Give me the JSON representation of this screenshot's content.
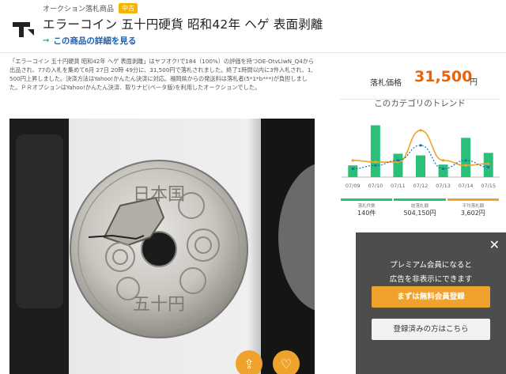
{
  "header": {
    "breadcrumb": "オークション落札商品",
    "badge": "中古",
    "title": "エラーコイン 五十円硬貨 昭和42年 ヘゲ 表面剥離",
    "detail_link": "この商品の詳細を見る"
  },
  "description": "「エラーコイン 五十円硬貨 昭和42年 ヘゲ 表面剥離」はヤフオク!で184（100%）の評価を持つOE-OtvLlwN_Q4から出品され、77の入札を集めて6月 27日 20時 49分に、31,500円で落札されました。終了1時間以内に3件入札され、1,500円上昇しました。決済方法はYahoo!かんたん決済に対応。福岡県からの発送料は落札者(5*1*b***)が負担しました。ＰＲオプションはYahoo!かんたん決済、取りナビ(ベータ版)を利用したオークションでした。",
  "photo": {
    "coin_text_top": "日本国",
    "coin_text_bottom": "五十円"
  },
  "sidebar": {
    "price_label": "落札価格",
    "price_value": "31,500",
    "price_unit": "円",
    "trend_title": "このカテゴリのトレンド",
    "stats": [
      {
        "label": "落札件数",
        "value": "140件",
        "color": "#2bc07a"
      },
      {
        "label": "総落札額",
        "value": "504,150円",
        "color": "#2bc07a"
      },
      {
        "label": "平均落札額",
        "value": "3,602円",
        "color": "#f0a32c"
      }
    ]
  },
  "chart_data": {
    "type": "bar",
    "categories": [
      "07/09",
      "07/10",
      "07/11",
      "07/12",
      "07/13",
      "07/14",
      "07/15"
    ],
    "series": [
      {
        "values": [
          14,
          62,
          28,
          26,
          15,
          47,
          29
        ],
        "color": "#2bc07a"
      },
      {
        "values": [
          20,
          18,
          18,
          56,
          20,
          14,
          16
        ],
        "color": "#f0a32c"
      },
      {
        "values": [
          10,
          14,
          20,
          38,
          10,
          20,
          12
        ],
        "color": "#1a6fb4"
      }
    ]
  },
  "popup": {
    "line1": "プレミアム会員になると",
    "line2": "広告を非表示にできます",
    "primary_button": "まずは無料会員登録",
    "secondary_button": "登録済みの方はこちら"
  }
}
